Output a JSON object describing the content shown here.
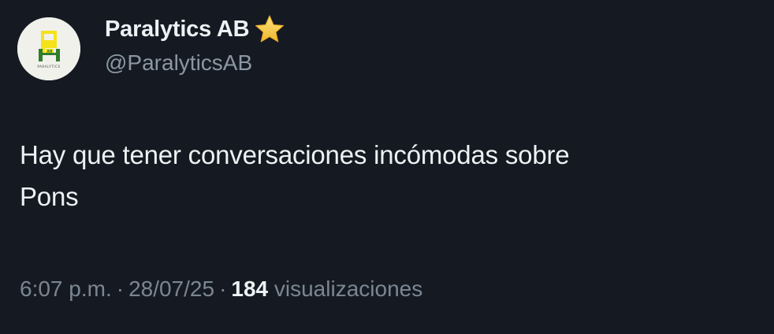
{
  "author": {
    "display_name": "Paralytics AB",
    "handle": "@ParalyticsAB",
    "avatar_text": "PARALYTICS",
    "verified_icon": "star-icon"
  },
  "tweet": {
    "line1": "Hay que tener conversaciones incómodas sobre",
    "line2": "Pons"
  },
  "meta": {
    "time": "6:07 p.m.",
    "separator": "·",
    "date": "28/07/25",
    "views_count": "184",
    "views_label": "visualizaciones"
  },
  "colors": {
    "background": "#151a22",
    "text_primary": "#eef1f4",
    "text_secondary": "#8b97a3",
    "logo_green": "#2f7d2d",
    "logo_yellow": "#f4e21a",
    "star": "#f6c945"
  }
}
